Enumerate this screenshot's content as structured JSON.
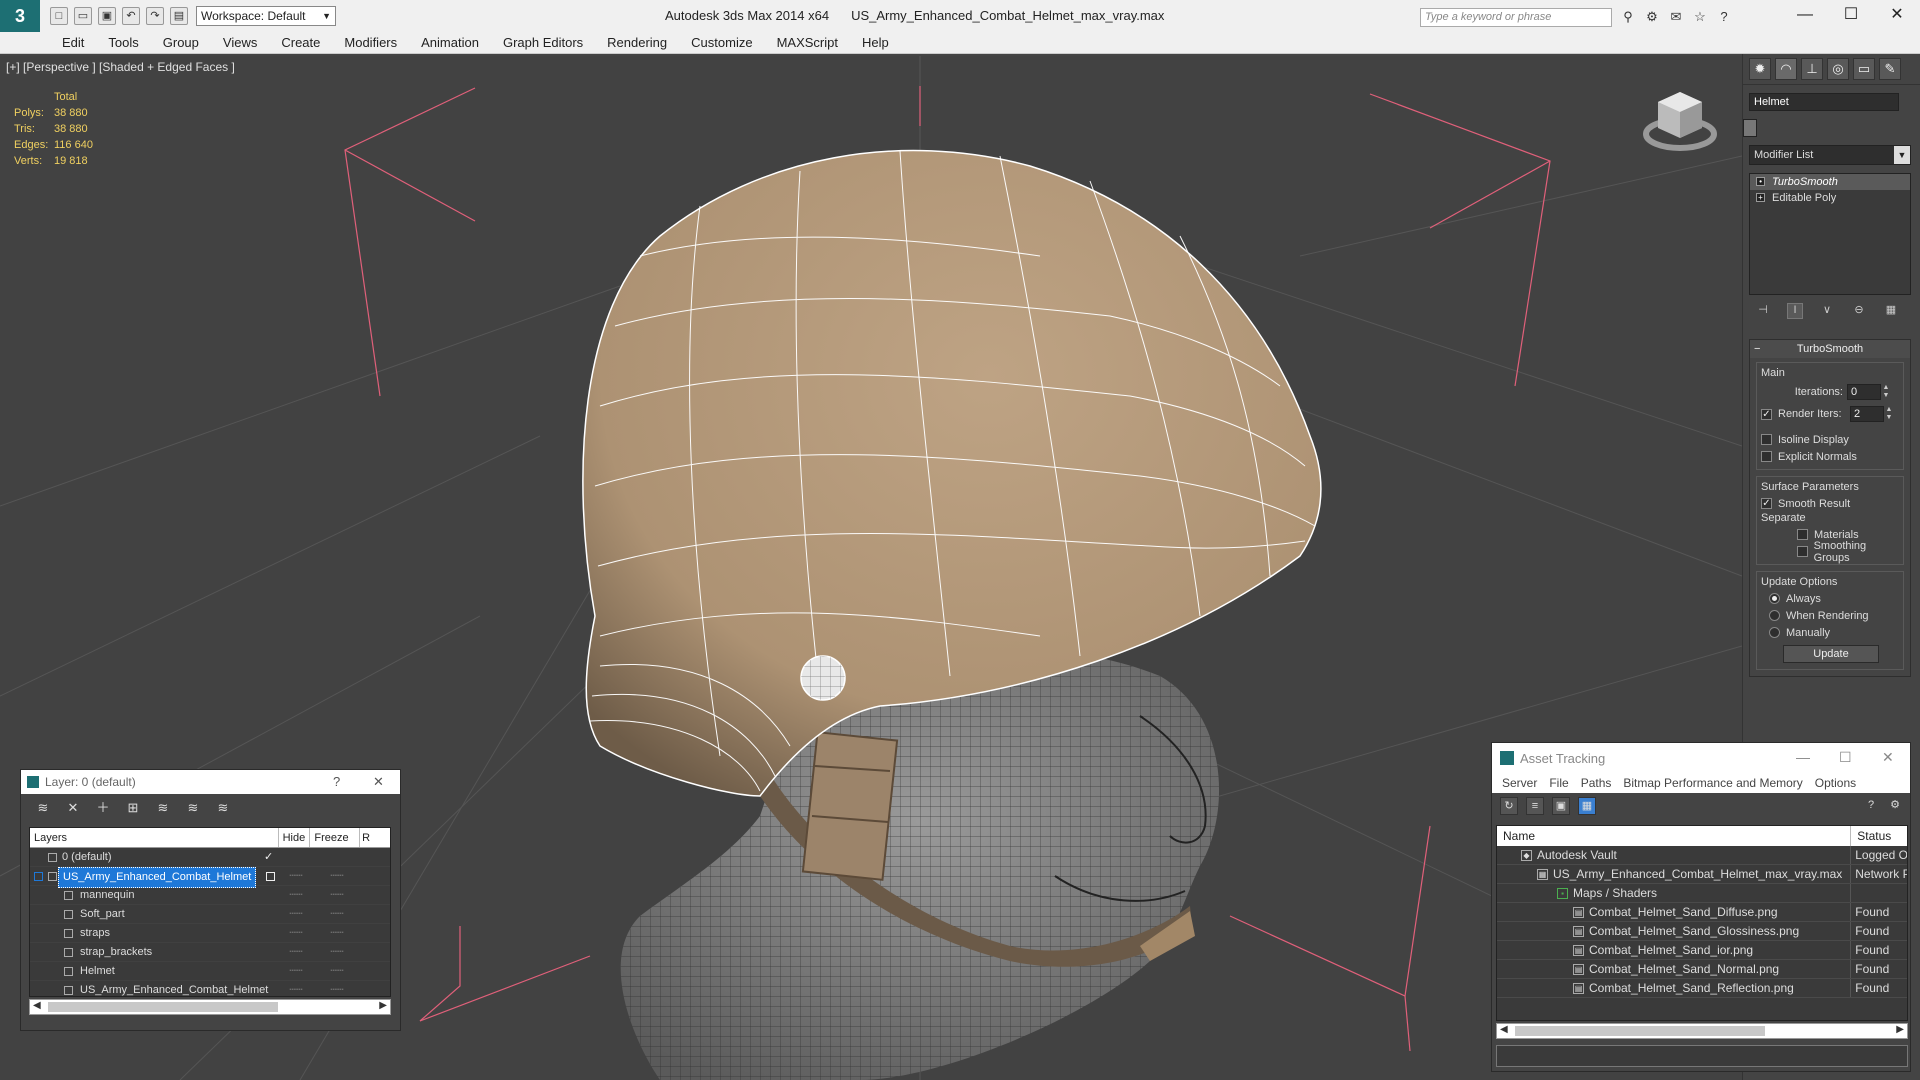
{
  "app": {
    "title_app": "Autodesk 3ds Max  2014 x64",
    "title_file": "US_Army_Enhanced_Combat_Helmet_max_vray.max",
    "workspace": "Workspace: Default",
    "search_placeholder": "Type a keyword or phrase",
    "logo": "3"
  },
  "menu": [
    "Edit",
    "Tools",
    "Group",
    "Views",
    "Create",
    "Modifiers",
    "Animation",
    "Graph Editors",
    "Rendering",
    "Customize",
    "MAXScript",
    "Help"
  ],
  "viewport": {
    "label": "[+] [Perspective ] [Shaded + Edged Faces ]",
    "stats_header": "Total",
    "stats": [
      {
        "k": "Polys:",
        "v": "38 880"
      },
      {
        "k": "Tris:",
        "v": "38 880"
      },
      {
        "k": "Edges:",
        "v": "116 640"
      },
      {
        "k": "Verts:",
        "v": "19 818"
      }
    ]
  },
  "command_panel": {
    "object_name": "Helmet",
    "modifier_list": "Modifier List",
    "stack": [
      "TurboSmooth",
      "Editable Poly"
    ],
    "rollout_title": "TurboSmooth",
    "main_group": "Main",
    "iterations_label": "Iterations:",
    "iterations_value": "0",
    "render_iters_label": "Render Iters:",
    "render_iters_value": "2",
    "isoline": "Isoline Display",
    "explicit_normals": "Explicit Normals",
    "surface_group": "Surface Parameters",
    "smooth_result": "Smooth Result",
    "separate": "Separate",
    "materials": "Materials",
    "smoothing_groups": "Smoothing Groups",
    "update_group": "Update Options",
    "always": "Always",
    "when_rendering": "When Rendering",
    "manually": "Manually",
    "update_btn": "Update"
  },
  "layer_window": {
    "title": "Layer: 0 (default)",
    "help": "?",
    "close": "✕",
    "col_layers": "Layers",
    "col_hide": "Hide",
    "col_freeze": "Freeze",
    "col_r": "R",
    "rows": [
      {
        "name": "0 (default)",
        "hide": "",
        "freeze": ""
      },
      {
        "name": "US_Army_Enhanced_Combat_Helmet",
        "hide": "┄┄",
        "freeze": "┄┄"
      },
      {
        "name": "mannequin",
        "hide": "┄┄",
        "freeze": "┄┄"
      },
      {
        "name": "Soft_part",
        "hide": "┄┄",
        "freeze": "┄┄"
      },
      {
        "name": "straps",
        "hide": "┄┄",
        "freeze": "┄┄"
      },
      {
        "name": "strap_brackets",
        "hide": "┄┄",
        "freeze": "┄┄"
      },
      {
        "name": "Helmet",
        "hide": "┄┄",
        "freeze": "┄┄"
      },
      {
        "name": "US_Army_Enhanced_Combat_Helmet",
        "hide": "┄┄",
        "freeze": "┄┄"
      }
    ]
  },
  "asset_window": {
    "title": "Asset Tracking",
    "menu": [
      "Server",
      "File",
      "Paths",
      "Bitmap Performance and Memory",
      "Options"
    ],
    "col_name": "Name",
    "col_status": "Status",
    "rows": [
      {
        "name": "Autodesk Vault",
        "status": "Logged Ou"
      },
      {
        "name": "US_Army_Enhanced_Combat_Helmet_max_vray.max",
        "status": "Network P"
      },
      {
        "name": "Maps / Shaders",
        "status": ""
      },
      {
        "name": "Combat_Helmet_Sand_Diffuse.png",
        "status": "Found"
      },
      {
        "name": "Combat_Helmet_Sand_Glossiness.png",
        "status": "Found"
      },
      {
        "name": "Combat_Helmet_Sand_ior.png",
        "status": "Found"
      },
      {
        "name": "Combat_Helmet_Sand_Normal.png",
        "status": "Found"
      },
      {
        "name": "Combat_Helmet_Sand_Reflection.png",
        "status": "Found"
      }
    ]
  },
  "colors": {
    "accent": "#1e78d8",
    "stats": "#f0d060",
    "helmet": "#b59a7b",
    "bbox": "#e0607a"
  }
}
